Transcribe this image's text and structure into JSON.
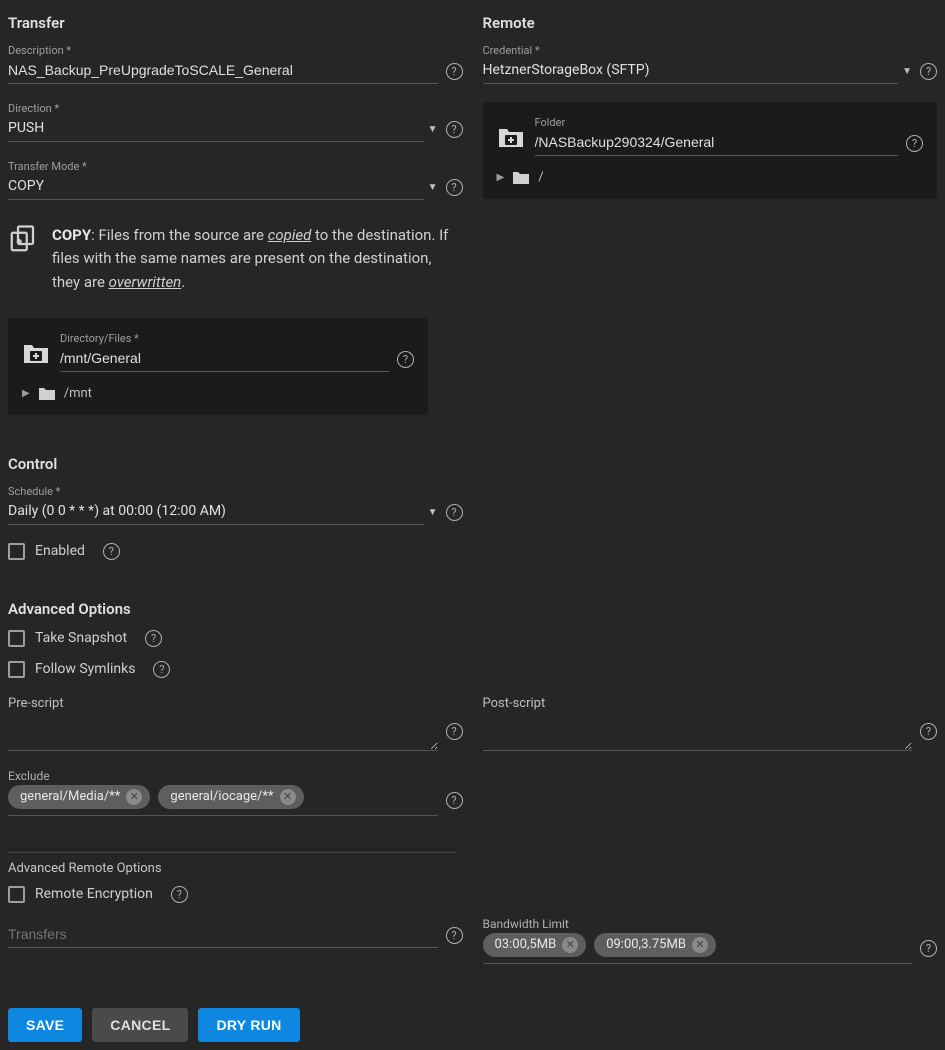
{
  "transfer": {
    "title": "Transfer",
    "description_label": "Description *",
    "description_value": "NAS_Backup_PreUpgradeToSCALE_General",
    "direction_label": "Direction *",
    "direction_value": "PUSH",
    "mode_label": "Transfer Mode *",
    "mode_value": "COPY",
    "info_bold": "COPY",
    "info_pre": ": Files from the source are ",
    "info_copied": "copied",
    "info_mid": " to the destination. If files with the same names are present on the destination, they are ",
    "info_overwritten": "overwritten",
    "info_end": ".",
    "dir_label": "Directory/Files *",
    "dir_value": "/mnt/General",
    "dir_tree_root": "/mnt"
  },
  "remote": {
    "title": "Remote",
    "credential_label": "Credential *",
    "credential_value": "HetznerStorageBox (SFTP)",
    "folder_label": "Folder",
    "folder_value": "/NASBackup290324/General",
    "folder_tree_root": "/"
  },
  "control": {
    "title": "Control",
    "schedule_label": "Schedule *",
    "schedule_value": "Daily (0 0 * * *) at 00:00 (12:00 AM)",
    "enabled_label": "Enabled"
  },
  "advanced": {
    "title": "Advanced Options",
    "take_snapshot_label": "Take Snapshot",
    "follow_symlinks_label": "Follow Symlinks",
    "pre_script_label": "Pre-script",
    "post_script_label": "Post-script",
    "exclude_label": "Exclude",
    "exclude_chips": [
      "general/Media/**",
      "general/iocage/**"
    ],
    "adv_remote_title": "Advanced Remote Options",
    "remote_encryption_label": "Remote Encryption",
    "transfers_label": "Transfers",
    "bandwidth_label": "Bandwidth Limit",
    "bandwidth_chips": [
      "03:00,5MB",
      "09:00,3.75MB"
    ]
  },
  "buttons": {
    "save": "SAVE",
    "cancel": "CANCEL",
    "dry_run": "DRY RUN"
  }
}
